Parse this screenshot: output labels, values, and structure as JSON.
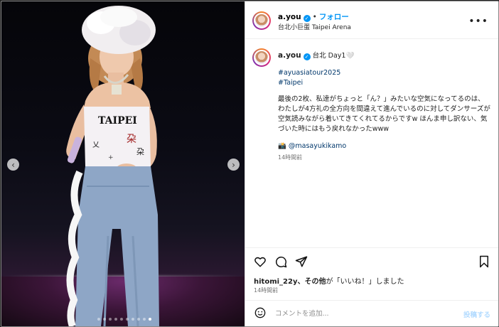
{
  "post": {
    "username": "a.you",
    "separator": "•",
    "follow_label": "フォロー",
    "location": "台北小巨蛋 Taipei Arena",
    "more_icon": "more-horizontal-icon"
  },
  "caption": {
    "username": "a.you",
    "title": "台北 Day1🤍",
    "hashtags": [
      "#ayuasiatour2025",
      "#Taipei"
    ],
    "text": "最後の2枚、私達がちょっと「ん？」みたいな空気になってるのは、わたしが4方礼の全方向を間違えて進んでいるのに対してダンサーズが空気読みながら着いてきてくれてるからですw ほんま申し訳ない、気づいた時にはもう戻れなかったwww",
    "credit_emoji": "📸",
    "credit": "@masayukikamo",
    "time": "14時間前"
  },
  "media": {
    "shirt_text": "TAIPEI",
    "slide_count": 10,
    "active_slide": 1
  },
  "engagement": {
    "likes_user": "hitomi_22y",
    "likes_suffix": "、その他",
    "likes_text": "が「いいね！」しました",
    "time": "14時間前"
  },
  "comment": {
    "placeholder": "コメントを追加...",
    "post_label": "投稿する"
  },
  "colors": {
    "accent": "#0095f6",
    "link": "#00376b",
    "post_disabled": "#b3dbff"
  }
}
